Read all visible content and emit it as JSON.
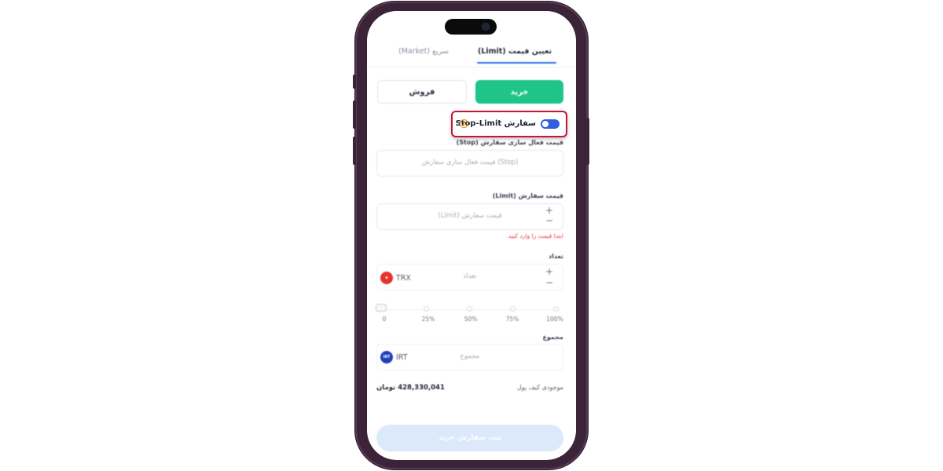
{
  "tabs": {
    "limit": "تعیین قیمت (Limit)",
    "market": "سریع (Market)"
  },
  "side_buttons": {
    "buy": "خرید",
    "sell": "فروش"
  },
  "stop_limit": {
    "label": "سفارش Stop-Limit",
    "toggle_on": true,
    "help_glyph": "?",
    "highlight_color": "#c4153a"
  },
  "stop_price": {
    "label": "قیمت فعال سازی سفارش (Stop)",
    "placeholder": "(Stop) قیمت فعال سازی سفارش"
  },
  "limit_price": {
    "label": "قیمت سفارش (Limit)",
    "placeholder": "قیمت سفارش (Limit)",
    "error": "ابتدا قیمت را وارد کنید."
  },
  "amount": {
    "label": "تعداد",
    "placeholder": "تعداد",
    "asset": "TRX",
    "asset_icon": "tron-icon"
  },
  "slider": {
    "labels": [
      "0",
      "25%",
      "50%",
      "75%",
      "100%"
    ],
    "value_percent": 0
  },
  "total": {
    "label": "مجموع",
    "placeholder": "مجموع",
    "asset": "IRT",
    "asset_icon": "toman-icon",
    "asset_glyph": "IRT"
  },
  "balance": {
    "label": "موجودی کیف پول",
    "value": "428,330,041 تومان"
  },
  "stepper": {
    "plus": "+",
    "minus": "−"
  },
  "submit": {
    "label": "ثبت سفارش خرید"
  },
  "colors": {
    "buy_green": "#1ec488",
    "accent_blue": "#2f6fe8",
    "error_red": "#e53935"
  }
}
